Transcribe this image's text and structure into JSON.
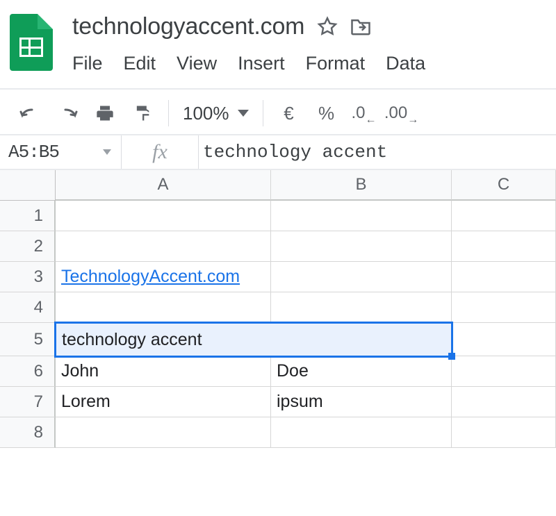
{
  "doc": {
    "title": "technologyaccent.com"
  },
  "menus": [
    "File",
    "Edit",
    "View",
    "Insert",
    "Format",
    "Data"
  ],
  "toolbar": {
    "zoom": "100%",
    "currency_symbol": "€",
    "percent_symbol": "%",
    "dec_decrease": ".0",
    "dec_increase": ".00"
  },
  "formula": {
    "range": "A5:B5",
    "fx_label": "fx",
    "content": "technology accent"
  },
  "grid": {
    "columns": [
      "A",
      "B",
      "C"
    ],
    "rows": [
      "1",
      "2",
      "3",
      "4",
      "5",
      "6",
      "7",
      "8"
    ],
    "cells": {
      "A3": "TechnologyAccent.com",
      "A5": "technology accent",
      "A6": "John",
      "B6": "Doe",
      "A7": "Lorem",
      "B7": "ipsum"
    }
  }
}
